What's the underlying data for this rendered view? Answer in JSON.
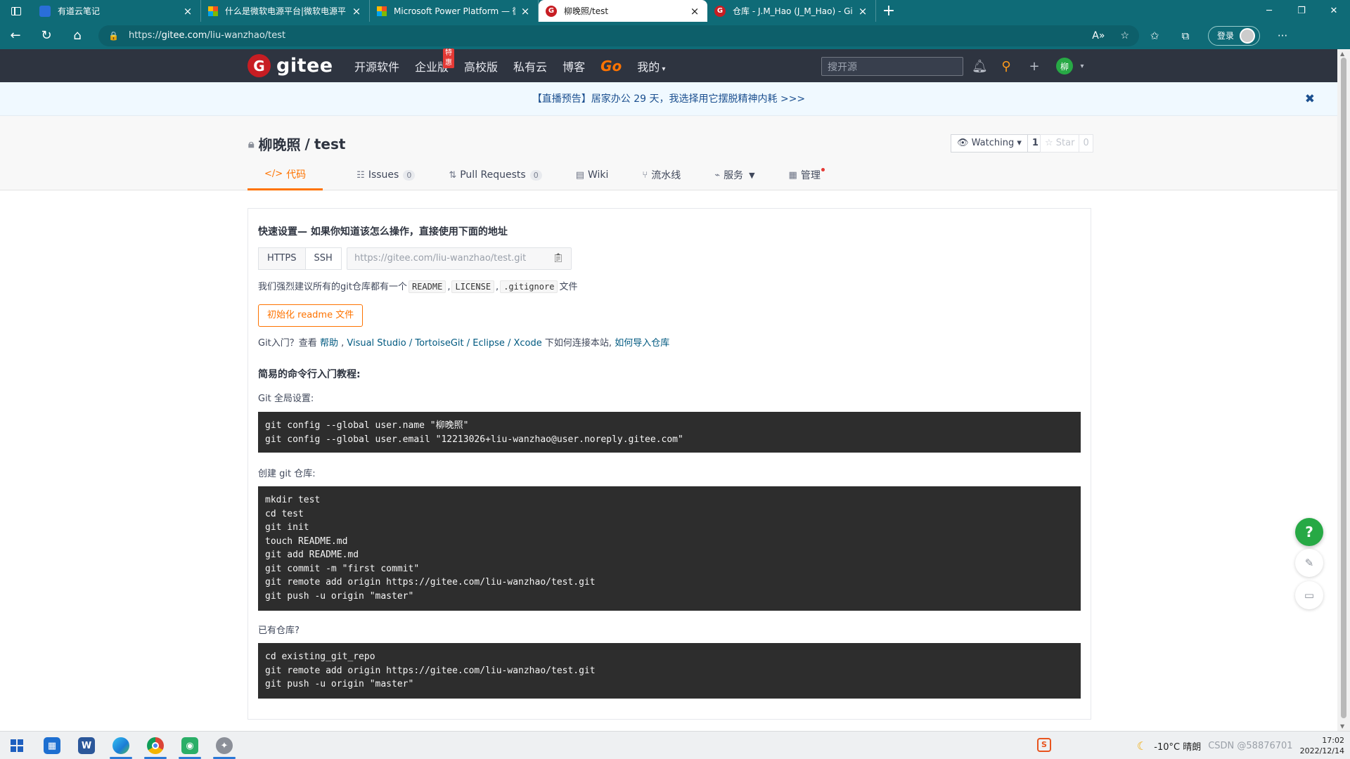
{
  "browser": {
    "tabs": [
      {
        "title": "有道云笔记",
        "favicon": "note-icon",
        "active": false
      },
      {
        "title": "什么是微软电源平台|微软电源平",
        "favicon": "microsoft-icon",
        "active": false
      },
      {
        "title": "Microsoft Power Platform — 微软",
        "favicon": "microsoft-icon",
        "active": false
      },
      {
        "title": "柳晚照/test",
        "favicon": "gitee-icon",
        "active": true
      },
      {
        "title": "仓库 - J.M_Hao (J_M_Hao) - Gitee",
        "favicon": "gitee-icon",
        "active": false
      }
    ],
    "url_prefix": "https://",
    "url_host": "gitee.com",
    "url_path": "/liu-wanzhao/test",
    "login_label": "登录"
  },
  "gitee_nav": {
    "logo_letter": "G",
    "logo_text": "gitee",
    "menu": [
      "开源软件",
      "企业版",
      "高校版",
      "私有云",
      "博客"
    ],
    "hot_badge": "特惠",
    "go_label": "Go",
    "mine_label": "我的",
    "search_placeholder": "搜开源",
    "user_initial": "柳"
  },
  "notice": {
    "text": "【直播预告】居家办公 29 天，我选择用它摆脱精神内耗 >>>"
  },
  "repo": {
    "owner": "柳晚照",
    "separator": "/",
    "name": "test",
    "watch_label": "Watching",
    "watch_count": "1",
    "star_label": "Star",
    "star_count": "0",
    "tabs": [
      {
        "icon": "code-icon",
        "label": "代码",
        "count": null,
        "active": true
      },
      {
        "icon": "issues-icon",
        "label": "Issues",
        "count": "0",
        "active": false
      },
      {
        "icon": "pull-request-icon",
        "label": "Pull Requests",
        "count": "0",
        "active": false
      },
      {
        "icon": "wiki-icon",
        "label": "Wiki",
        "count": null,
        "active": false
      },
      {
        "icon": "pipeline-icon",
        "label": "流水线",
        "count": null,
        "active": false
      },
      {
        "icon": "service-icon",
        "label": "服务",
        "count": null,
        "active": false
      },
      {
        "icon": "manage-icon",
        "label": "管理",
        "count": null,
        "active": false
      }
    ]
  },
  "quick_setup": {
    "heading": "快速设置— 如果你知道该怎么操作，直接使用下面的地址",
    "protocols": [
      "HTTPS",
      "SSH"
    ],
    "clone_url": "https://gitee.com/liu-wanzhao/test.git",
    "advice_prefix": "我们强烈建议所有的git仓库都有一个",
    "advice_files": [
      "README",
      "LICENSE",
      ".gitignore"
    ],
    "advice_suffix": "文件",
    "init_button": "初始化 readme 文件",
    "help_prefix": "Git入门？查看",
    "help_link": "帮助",
    "tools": "Visual Studio / TortoiseGit / Eclipse / Xcode",
    "help_middle": "下如何连接本站,",
    "import_link": "如何导入仓库"
  },
  "tutorial": {
    "heading": "简易的命令行入门教程:",
    "global_label": "Git 全局设置:",
    "global_code": "git config --global user.name \"柳晚照\"\ngit config --global user.email \"12213026+liu-wanzhao@user.noreply.gitee.com\"",
    "create_label": "创建 git 仓库:",
    "create_code": "mkdir test\ncd test\ngit init\ntouch README.md\ngit add README.md\ngit commit -m \"first commit\"\ngit remote add origin https://gitee.com/liu-wanzhao/test.git\ngit push -u origin \"master\"",
    "existing_label": "已有仓库?",
    "existing_code": "cd existing_git_repo\ngit remote add origin https://gitee.com/liu-wanzhao/test.git\ngit push -u origin \"master\""
  },
  "taskbar": {
    "weather": "-10°C 晴朗",
    "watermark": "CSDN @58876701",
    "time": "17:02",
    "date": "2022/12/14"
  },
  "colors": {
    "accent": "#fe7300",
    "nav_bg": "#2e3440",
    "browser_frame": "#0f6b77",
    "code_bg": "#2d2d2d"
  }
}
